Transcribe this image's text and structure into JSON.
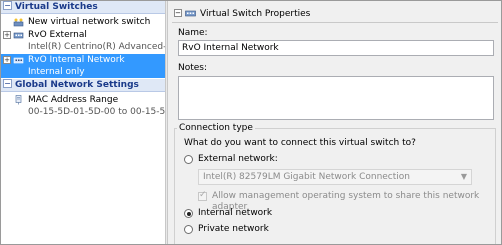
{
  "tree": {
    "virtual_switches_header": "Virtual Switches",
    "items": [
      {
        "label": "New virtual network switch"
      },
      {
        "label": "RvO External",
        "sublabel": "Intel(R) Centrino(R) Advanced-N 6..."
      },
      {
        "label": "RvO Internal Network",
        "sublabel": "Internal only",
        "selected": true
      }
    ],
    "global_header": "Global Network Settings",
    "global_items": [
      {
        "label": "MAC Address Range",
        "sublabel": "00-15-5D-01-5D-00 to 00-15-5D-0..."
      }
    ],
    "expander_plus": "+",
    "expander_minus": "−"
  },
  "properties": {
    "title": "Virtual Switch Properties",
    "name_label": "Name:",
    "name_value": "RvO Internal Network",
    "notes_label": "Notes:",
    "notes_value": "",
    "connection_type": {
      "title": "Connection type",
      "question": "What do you want to connect this virtual switch to?",
      "external_label": "External network:",
      "adapter_value": "Intel(R) 82579LM Gigabit Network Connection",
      "allow_mgmt_label": "Allow management operating system to share this network adapter",
      "internal_label": "Internal network",
      "private_label": "Private network",
      "selected": "internal"
    }
  },
  "colors": {
    "selection": "#3399ff",
    "section_header_bg": "#dfe8f6",
    "section_header_text": "#1a3a8a",
    "pane_bg": "#f0f0f0"
  },
  "icons": {
    "switch": "network-switch-icon",
    "mac": "mac-address-icon",
    "header": "virtual-switch-properties-icon"
  }
}
